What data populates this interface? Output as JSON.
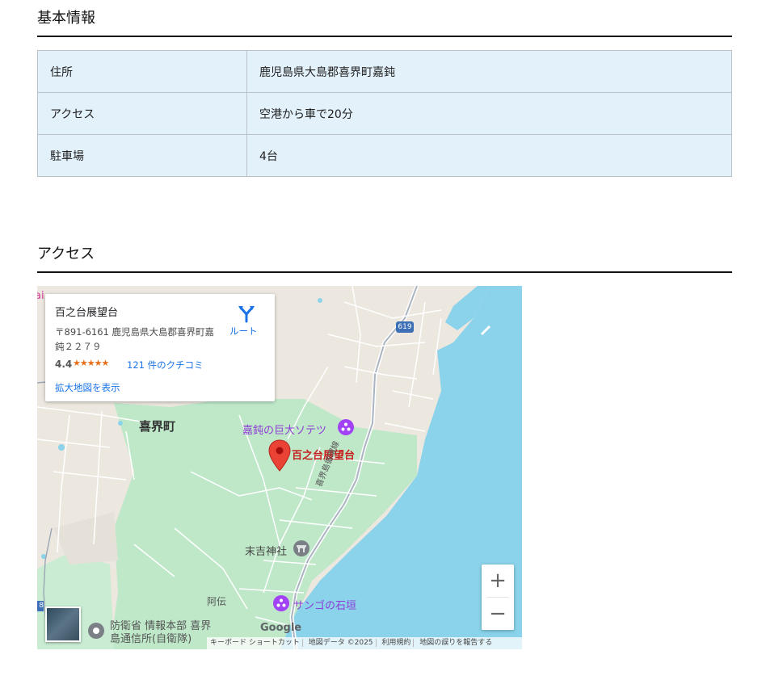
{
  "basic_info": {
    "title": "基本情報",
    "rows": [
      {
        "key": "住所",
        "value": "鹿児島県大島郡喜界町嘉鈍"
      },
      {
        "key": "アクセス",
        "value": "空港から車で20分"
      },
      {
        "key": "駐車場",
        "value": "4台"
      }
    ]
  },
  "access": {
    "title": "アクセス"
  },
  "map": {
    "card": {
      "title": "百之台展望台",
      "address": "〒891-6161 鹿児島県大島郡喜界町嘉鈍２２７９",
      "rating": "4.4",
      "stars": "★★★★★",
      "reviews": "121 件のクチコミ",
      "route_label": "ルート",
      "enlarge_label": "拡大地図を表示"
    },
    "labels": {
      "town": "喜界町",
      "cycad": "嘉鈍の巨大ソテツ",
      "place": "百之台展望台",
      "road": "喜界島循環線",
      "shrine": "末吉神社",
      "ade": "阿伝",
      "coral": "サンゴの石垣",
      "mod1": "防衛省 情報本部 喜界",
      "mod2": "島通信所(自衛隊)",
      "route_no": "619",
      "edge_8": "8",
      "edge_ai": "ai"
    },
    "zoom_in": "+",
    "zoom_out": "−",
    "logo": "Google",
    "attribution": {
      "shortcuts": "キーボード ショートカット",
      "data": "地図データ ©2025",
      "terms": "利用規約",
      "report": "地図の誤りを報告する"
    },
    "colors": {
      "sea": "#8ad3ea",
      "park": "#bfe8c9",
      "land": "#ece7df",
      "pin": "#ea4335",
      "poi_purple": "#a142f4",
      "link": "#1a73e8"
    }
  }
}
